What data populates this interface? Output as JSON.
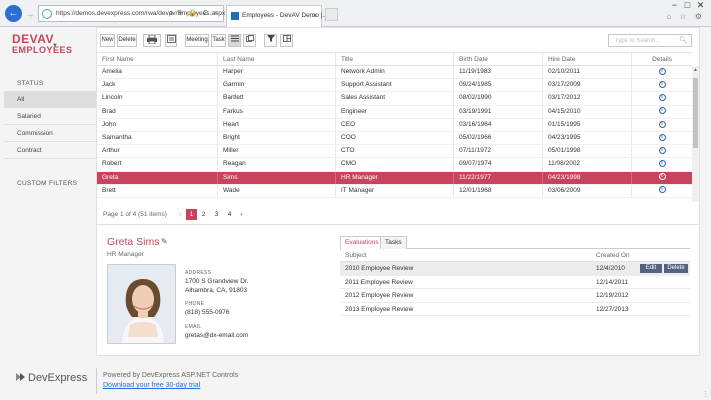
{
  "browser": {
    "url": "https://demos.devexpress.com/rwa/devav/Employees.aspx",
    "tab_title": "Employees - DevAV Demo |...",
    "addr_icons": "ρ ▾ 🔒 C ×",
    "window_controls": [
      "−",
      "□",
      "✕"
    ],
    "home_icons": "⌂ ☆ ⚙"
  },
  "logo": {
    "line1": "DEVAV",
    "line2": "EMPLOYEES"
  },
  "sidebar": {
    "status_heading": "STATUS",
    "items": [
      {
        "label": "All",
        "active": true
      },
      {
        "label": "Salaried",
        "active": false
      },
      {
        "label": "Commission",
        "active": false
      },
      {
        "label": "Contract",
        "active": false
      }
    ],
    "custom_filters_label": "CUSTOM FILTERS"
  },
  "toolbar": {
    "new_label": "New",
    "delete_label": "Delete",
    "meeting_label": "Meeting",
    "task_label": "Task",
    "search_placeholder": "Type to Search..."
  },
  "grid": {
    "columns": [
      "First Name",
      "Last Name",
      "Title",
      "Birth Date",
      "Hire Date",
      "Details"
    ],
    "rows": [
      {
        "first": "Amelia",
        "last": "Harper",
        "title": "Network Admin",
        "birth": "11/19/1983",
        "hire": "02/10/2011"
      },
      {
        "first": "Jack",
        "last": "Garmin",
        "title": "Support Assistant",
        "birth": "09/24/1985",
        "hire": "03/17/2009"
      },
      {
        "first": "Lincoln",
        "last": "Bartlett",
        "title": "Sales Assistant",
        "birth": "08/02/1990",
        "hire": "03/17/2012"
      },
      {
        "first": "Brad",
        "last": "Farkus",
        "title": "Engineer",
        "birth": "03/19/1991",
        "hire": "04/15/2010"
      },
      {
        "first": "John",
        "last": "Heart",
        "title": "CEO",
        "birth": "03/16/1964",
        "hire": "01/15/1995"
      },
      {
        "first": "Samantha",
        "last": "Bright",
        "title": "COO",
        "birth": "05/02/1966",
        "hire": "04/23/1995"
      },
      {
        "first": "Arthur",
        "last": "Miller",
        "title": "CTO",
        "birth": "07/11/1972",
        "hire": "05/01/1998"
      },
      {
        "first": "Robert",
        "last": "Reagan",
        "title": "CMO",
        "birth": "09/07/1974",
        "hire": "11/08/2002"
      },
      {
        "first": "Greta",
        "last": "Sims",
        "title": "HR Manager",
        "birth": "11/22/1977",
        "hire": "04/23/1998"
      },
      {
        "first": "Brett",
        "last": "Wade",
        "title": "IT Manager",
        "birth": "12/01/1968",
        "hire": "03/06/2009"
      }
    ],
    "selected_index": 8,
    "details_icon": "i"
  },
  "pager": {
    "summary": "Page 1 of 4 (51 items)",
    "prev": "‹",
    "next": "›",
    "pages": [
      "1",
      "2",
      "3",
      "4"
    ],
    "current": "1"
  },
  "detail": {
    "name": "Greta Sims",
    "title": "HR Manager",
    "address_label": "ADDRESS",
    "address_line1": "1700 S Grandview Dr.",
    "address_line2": "Alhambra, CA, 91803",
    "phone_label": "PHONE",
    "phone": "(818) 555-0976",
    "email_label": "EMAIL",
    "email": "gretas@dx-email.com"
  },
  "evaluations": {
    "tabs": [
      "Evaluations",
      "Tasks"
    ],
    "active_tab": "Evaluations",
    "columns": [
      "Subject",
      "Created On"
    ],
    "rows": [
      {
        "subject": "2010 Employee Review",
        "date": "12/4/2010"
      },
      {
        "subject": "2011 Employee Review",
        "date": "12/14/2011"
      },
      {
        "subject": "2012 Employee Review",
        "date": "12/19/2012"
      },
      {
        "subject": "2013 Employee Review",
        "date": "12/27/2013"
      }
    ],
    "edit_label": "Edit",
    "delete_label": "Delete"
  },
  "footer": {
    "brand": "DevExpress",
    "brand_sub": "",
    "powered_by": "Powered by DevExpress ASP.NET Controls",
    "trial_link": "Download your free 30-day trial"
  },
  "colors": {
    "accent": "#c8445c",
    "link": "#2a6fd1",
    "button_dark": "#556282"
  }
}
